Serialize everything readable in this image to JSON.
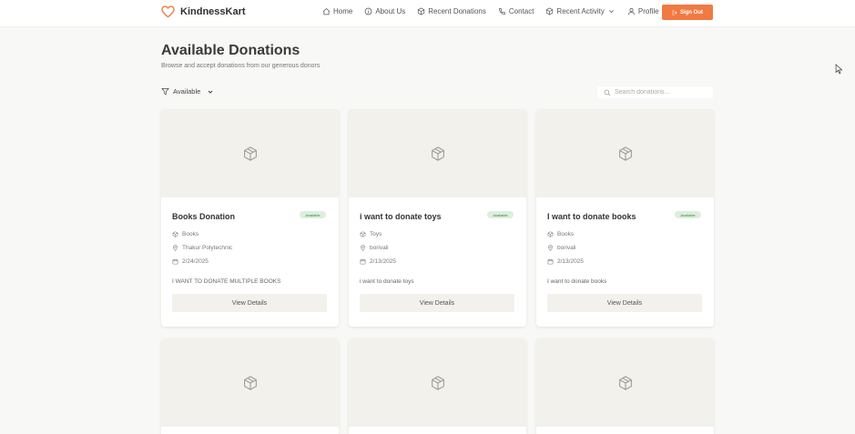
{
  "brand": {
    "name": "KindnessKart",
    "icon": "heart-icon",
    "accent": "#f07a42"
  },
  "nav": {
    "home": "Home",
    "about": "About Us",
    "recent_donations": "Recent Donations",
    "contact": "Contact",
    "recent_activity": "Recent Activity",
    "profile": "Profile",
    "sign_out": "Sign Out"
  },
  "page": {
    "title": "Available Donations",
    "subtitle": "Browse and accept donations from our generous donors"
  },
  "filter": {
    "selected": "Available"
  },
  "search": {
    "placeholder": "Search donations..."
  },
  "cards": [
    {
      "title": "Books Donation",
      "status": "Available",
      "category": "Books",
      "location": "Thakur Polytechnic",
      "date": "2/24/2025",
      "description": "I WANT TO DONATE MULTIPLE BOOKS",
      "button": "View Details"
    },
    {
      "title": "i want to donate toys",
      "status": "Available",
      "category": "Toys",
      "location": "borivali",
      "date": "2/13/2025",
      "description": "i want to donate toys",
      "button": "View Details"
    },
    {
      "title": "I want to donate books",
      "status": "Available",
      "category": "Books",
      "location": "borivali",
      "date": "2/13/2025",
      "description": "I want to donate books",
      "button": "View Details"
    }
  ],
  "status_colors": {
    "badge_bg": "#dcefdc",
    "badge_text": "#34833f"
  }
}
